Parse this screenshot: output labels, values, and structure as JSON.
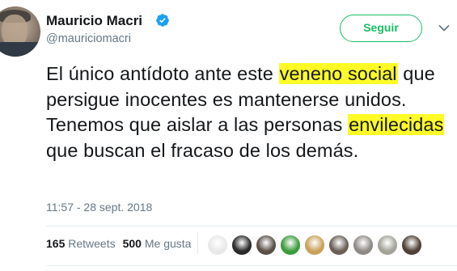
{
  "author": {
    "name": "Mauricio Macri",
    "handle": "@mauriciomacri",
    "verified": true
  },
  "follow_button": {
    "label": "Seguir"
  },
  "tweet": {
    "segments": [
      {
        "text": "El único antídoto ante este ",
        "highlight": false
      },
      {
        "text": "veneno social",
        "highlight": true
      },
      {
        "text": " que persigue inocentes es mantenerse unidos. Tenemos que aislar a las personas ",
        "highlight": false
      },
      {
        "text": "envilecidas",
        "highlight": true
      },
      {
        "text": " que buscan el fracaso de los demás.",
        "highlight": false
      }
    ],
    "timestamp": "11:57 - 28 sept. 2018"
  },
  "stats": {
    "retweets_count": "165",
    "retweets_label": "Retweets",
    "likes_count": "500",
    "likes_label": "Me gusta"
  },
  "liker_avatars": [
    {
      "icon": "liker-avatar-1",
      "color": "#e8e8e8"
    },
    {
      "icon": "liker-avatar-2",
      "color": "#2a2a2a"
    },
    {
      "icon": "liker-avatar-3",
      "color": "#5a5048"
    },
    {
      "icon": "liker-avatar-4",
      "color": "#3d9a3d"
    },
    {
      "icon": "liker-avatar-5",
      "color": "#c9a15a"
    },
    {
      "icon": "liker-avatar-6",
      "color": "#6b5f55"
    },
    {
      "icon": "liker-avatar-7",
      "color": "#8e8a86"
    },
    {
      "icon": "liker-avatar-8",
      "color": "#a3a39a"
    },
    {
      "icon": "liker-avatar-9",
      "color": "#4e4036"
    }
  ],
  "colors": {
    "follow_green": "#17bf63",
    "verified_blue": "#1da1f2",
    "highlight_yellow": "#fffb27",
    "secondary_text": "#657786"
  }
}
